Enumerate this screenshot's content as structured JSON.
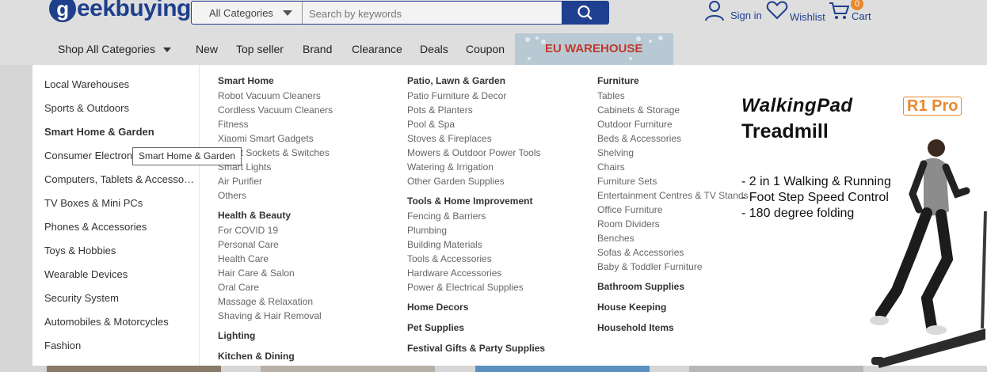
{
  "header": {
    "logo_text": "geekbuying",
    "search": {
      "category": "All Categories",
      "placeholder": "Search by keywords"
    },
    "sign_in": "Sign in",
    "wishlist": "Wishlist",
    "cart": "Cart",
    "cart_count": "0"
  },
  "nav": {
    "shop_all": "Shop All Categories",
    "items": [
      "New",
      "Top seller",
      "Brand",
      "Clearance",
      "Deals",
      "Coupon"
    ],
    "banner": "EU WAREHOUSE"
  },
  "sidebar": {
    "items": [
      "Local Warehouses",
      "Sports & Outdoors",
      "Smart Home & Garden",
      "Consumer Electronics",
      "Computers, Tablets & Accessories",
      "TV Boxes & Mini PCs",
      "Phones & Accessories",
      "Toys & Hobbies",
      "Wearable Devices",
      "Security System",
      "Automobiles & Motorcycles",
      "Fashion"
    ],
    "tooltip": "Smart Home & Garden"
  },
  "columns": [
    {
      "groups": [
        {
          "title": "Smart Home",
          "items": [
            "Robot Vacuum Cleaners",
            "Cordless Vacuum Cleaners",
            "Fitness",
            "Xiaomi Smart Gadgets",
            "Smart Sockets & Switches",
            "Smart Lights",
            "Air Purifier",
            "Others"
          ]
        },
        {
          "title": "Health & Beauty",
          "items": [
            "For COVID 19",
            "Personal Care",
            "Health Care",
            "Hair Care & Salon",
            "Oral Care",
            "Massage & Relaxation",
            "Shaving & Hair Removal"
          ]
        },
        {
          "title": "Lighting",
          "items": []
        },
        {
          "title": "Kitchen & Dining",
          "items": []
        }
      ]
    },
    {
      "groups": [
        {
          "title": "Patio, Lawn & Garden",
          "items": [
            "Patio Furniture & Decor",
            "Pots & Planters",
            "Pool & Spa",
            "Stoves & Fireplaces",
            "Mowers & Outdoor Power Tools",
            "Watering & Irrigation",
            "Other Garden Supplies"
          ]
        },
        {
          "title": "Tools & Home Improvement",
          "items": [
            "Fencing & Barriers",
            "Plumbing",
            "Building Materials",
            "Tools & Accessories",
            "Hardware Accessories",
            "Power & Electrical Supplies"
          ]
        },
        {
          "title": "Home Decors",
          "items": []
        },
        {
          "title": "Pet Supplies",
          "items": []
        },
        {
          "title": "Festival Gifts & Party Supplies",
          "items": []
        }
      ]
    },
    {
      "groups": [
        {
          "title": "Furniture",
          "items": [
            "Tables",
            "Cabinets & Storage",
            "Outdoor Furniture",
            "Beds & Accessories",
            "Shelving",
            "Chairs",
            "Furniture Sets",
            "Entertainment Centres & TV Stands",
            "Office Furniture",
            "Room Dividers",
            "Benches",
            "Sofas & Accessories",
            "Baby & Toddler Furniture"
          ]
        },
        {
          "title": "Bathroom Supplies",
          "items": []
        },
        {
          "title": "House Keeping",
          "items": []
        },
        {
          "title": "Household Items",
          "items": []
        }
      ]
    }
  ],
  "promo": {
    "brand": "WalkingPad",
    "model": "R1 Pro",
    "title": "Treadmill",
    "features": [
      "- 2 in 1 Walking & Running",
      "- Foot Step Speed Control",
      "- 180 degree folding"
    ]
  },
  "icons": [
    "search-icon",
    "user-icon",
    "heart-icon",
    "cart-icon",
    "chevron-down-icon"
  ],
  "colors": {
    "brand_blue": "#1f3f8f",
    "accent_orange": "#e8892d",
    "eu_red": "#c0392b"
  }
}
